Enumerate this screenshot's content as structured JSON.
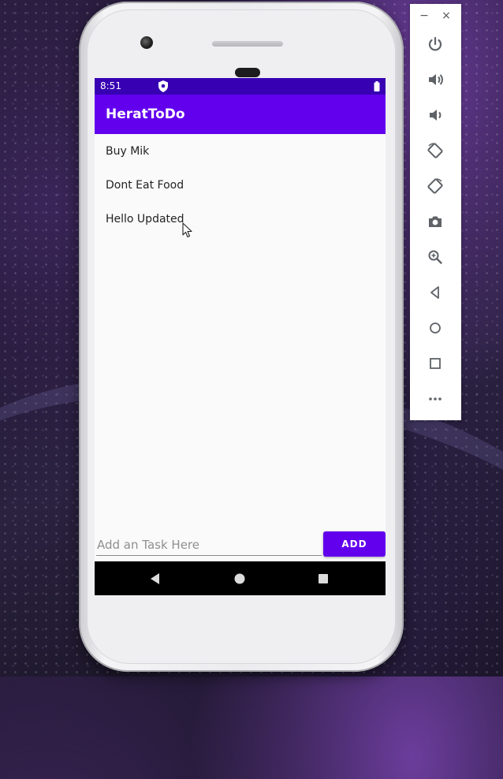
{
  "status_bar": {
    "time": "8:51"
  },
  "app": {
    "title": "HeratToDo"
  },
  "tasks": [
    {
      "label": "Buy Mik"
    },
    {
      "label": "Dont Eat Food"
    },
    {
      "label": "Hello Updated"
    }
  ],
  "input": {
    "placeholder": "Add an Task Here",
    "value": ""
  },
  "add_button": {
    "label": "ADD"
  },
  "emulator_toolbar": {
    "minimize": "−",
    "close": "×",
    "icons": [
      "power-icon",
      "volume-up-icon",
      "volume-down-icon",
      "rotate-left-icon",
      "rotate-right-icon",
      "camera-icon",
      "zoom-icon",
      "back-icon",
      "home-icon",
      "overview-icon",
      "more-icon"
    ]
  },
  "colors": {
    "status_bar": "#3700b3",
    "app_bar": "#6200ee",
    "accent": "#6200ee"
  }
}
